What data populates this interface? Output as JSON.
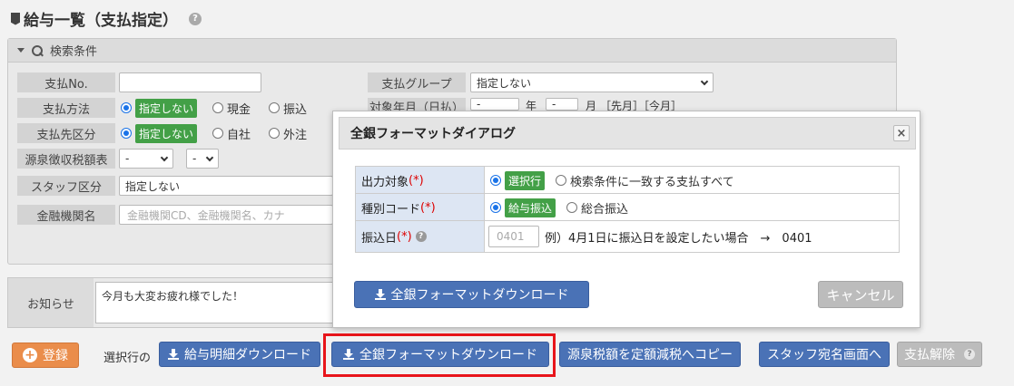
{
  "page": {
    "title": "給与一覧（支払指定）",
    "help_icon": "question-circle-icon"
  },
  "search": {
    "header": "検索条件",
    "fields": {
      "payment_no": {
        "label": "支払No.",
        "value": ""
      },
      "payment_method": {
        "label": "支払方法",
        "options": [
          "指定しない",
          "現金",
          "振込"
        ],
        "selected": "指定しない"
      },
      "payee_type": {
        "label": "支払先区分",
        "options": [
          "指定しない",
          "自社",
          "外注"
        ],
        "selected": "指定しない"
      },
      "withholding_table": {
        "label": "源泉徴収税額表",
        "select1": "-",
        "select2": "-"
      },
      "staff_type": {
        "label": "スタッフ区分",
        "value": "指定しない"
      },
      "bank_name": {
        "label": "金融機関名",
        "placeholder": "金融機関CD、金融機関名、カナ"
      },
      "payment_group": {
        "label": "支払グループ",
        "value": "指定しない"
      },
      "target_month": {
        "label": "対象年月（日払）",
        "year_select": "-",
        "year_unit": "年",
        "month_select": "-",
        "month_unit": "月",
        "links": "［先月］［今月］"
      }
    }
  },
  "notice": {
    "label": "お知らせ",
    "text": "今月も大変お疲れ様でした！"
  },
  "toolbar": {
    "register": "登録",
    "selected_rows_label": "選択行の",
    "payslip_download": "給与明細ダウンロード",
    "zengin_download": "全銀フォーマットダウンロード",
    "copy_tax": "源泉税額を定額減税へコピー",
    "staff_address": "スタッフ宛名画面へ",
    "cancel_payment": "支払解除"
  },
  "dialog": {
    "title": "全銀フォーマットダイアログ",
    "close": "×",
    "rows": [
      {
        "label": "出力対象",
        "required": "(*)",
        "options": [
          "選択行",
          "検索条件に一致する支払すべて"
        ],
        "selected": "選択行"
      },
      {
        "label": "種別コード",
        "required": "(*)",
        "options": [
          "給与振込",
          "総合振込"
        ],
        "selected": "給与振込"
      },
      {
        "label": "振込日",
        "required": "(*)",
        "placeholder": "0401",
        "example": "例）4月1日に振込日を設定したい場合　→　0401"
      }
    ],
    "download_button": "全銀フォーマットダウンロード",
    "cancel_button": "キャンセル"
  },
  "colors": {
    "primary_button": "#4a72b6",
    "register_button": "#ea8d4b",
    "selected_tag": "#43a047",
    "highlight_frame": "#e8151b"
  }
}
